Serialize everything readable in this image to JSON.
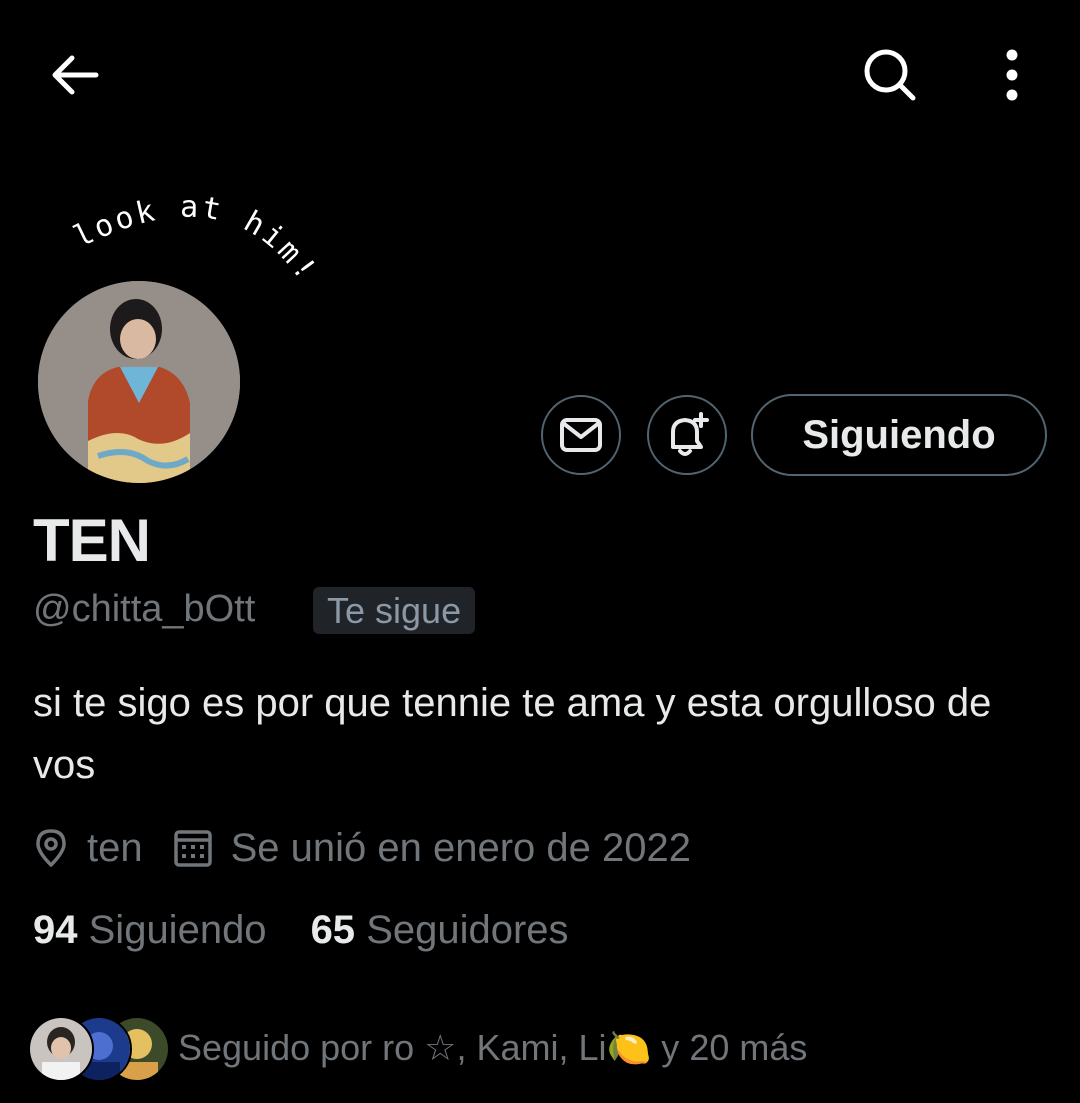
{
  "topbar": {
    "back_icon": "arrow-left-icon",
    "search_icon": "search-icon",
    "more_icon": "more-vertical-icon"
  },
  "header": {
    "sticker_text": "look at him!"
  },
  "actions": {
    "message_icon": "envelope-icon",
    "notify_icon": "bell-plus-icon",
    "following_label": "Siguiendo"
  },
  "profile": {
    "name": "TEN",
    "handle": "@chitta_bOtt",
    "follows_you_badge": "Te sigue",
    "bio": "si te sigo es por que tennie te ama y esta orgulloso de vos",
    "location": "ten",
    "joined": "Se unió en enero de 2022"
  },
  "stats": {
    "following_count": "94",
    "following_label": "Siguiendo",
    "followers_count": "65",
    "followers_label": "Seguidores"
  },
  "followed_by": {
    "text": "Seguido por ro ☆, Kami, Li🍋 y 20 más"
  },
  "colors": {
    "background": "#000000",
    "text_primary": "#e7e9ea",
    "text_secondary": "#71767b",
    "border": "#536471",
    "badge_bg": "#202327"
  }
}
